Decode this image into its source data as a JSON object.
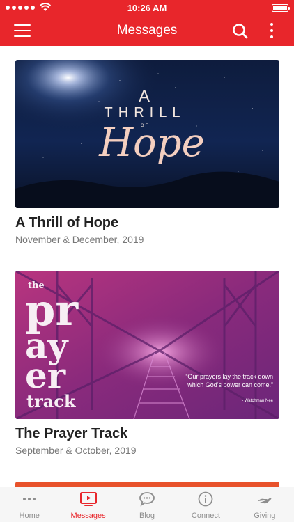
{
  "status": {
    "time": "10:26 AM",
    "battery_level": 1.0
  },
  "header": {
    "title": "Messages"
  },
  "messages": [
    {
      "title": "A Thrill of Hope",
      "date": "November & December, 2019",
      "art": {
        "line1": "A",
        "line2": "THRILL",
        "of": "OF",
        "script": "Hope"
      }
    },
    {
      "title": "The Prayer Track",
      "date": "September & October, 2019",
      "art": {
        "the": "the",
        "pr": "pr",
        "ay": "ay",
        "er": "er",
        "track": "track",
        "quote": "“Our prayers lay the track down which God's power can come.”",
        "author": "- Watchman Nee"
      }
    }
  ],
  "tabs": [
    {
      "label": "Home",
      "icon": "ellipsis-icon"
    },
    {
      "label": "Messages",
      "icon": "tv-play-icon",
      "active": true
    },
    {
      "label": "Blog",
      "icon": "chat-bubble-icon"
    },
    {
      "label": "Connect",
      "icon": "info-circle-icon"
    },
    {
      "label": "Giving",
      "icon": "giving-hand-icon"
    }
  ],
  "colors": {
    "accent": "#e8262b",
    "inactive": "#8e8e8e"
  }
}
